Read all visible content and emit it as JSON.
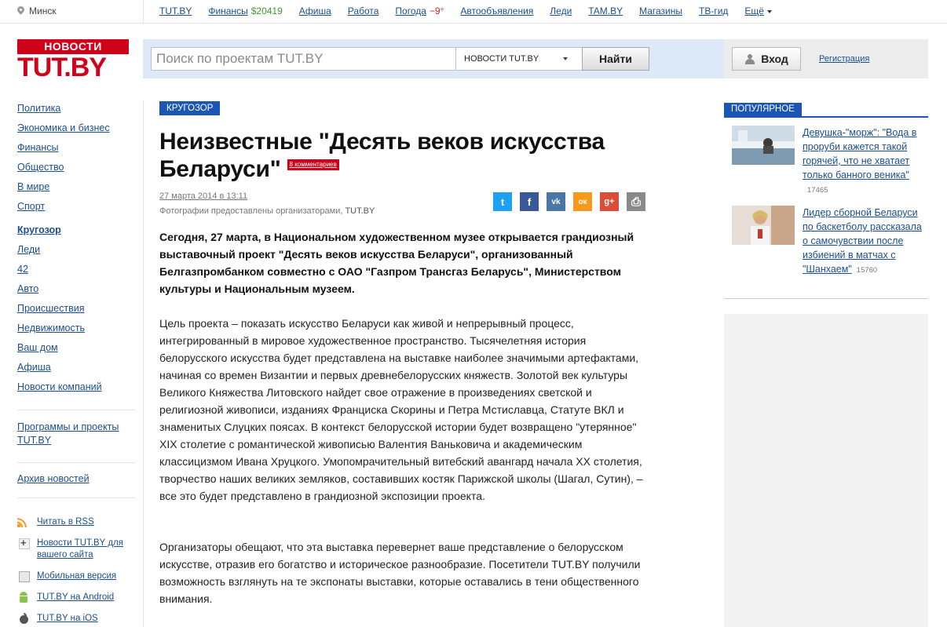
{
  "topbar": {
    "city": "Минск",
    "nav": [
      {
        "label": "TUT.BY"
      },
      {
        "label": "Финансы",
        "value": "$20419",
        "value_color": "#3a9b2a"
      },
      {
        "label": "Афиша"
      },
      {
        "label": "Работа"
      },
      {
        "label": "Погода",
        "value": "−9°",
        "value_color": "#c62828"
      },
      {
        "label": "Автообъявления"
      },
      {
        "label": "Леди"
      },
      {
        "label": "TAM.BY"
      },
      {
        "label": "Магазины"
      },
      {
        "label": "ТВ-гид"
      },
      {
        "label": "Ещё"
      }
    ]
  },
  "header": {
    "logo_top": "НОВОСТИ",
    "logo_main": "TUT.BY",
    "search_placeholder": "Поиск по проектам TUT.BY",
    "search_scope": "НОВОСТИ TUT.BY",
    "search_button": "Найти",
    "login_button": "Вход",
    "register_link": "Регистрация"
  },
  "sidebar": {
    "sections_group1": [
      "Политика",
      "Экономика и бизнес",
      "Финансы",
      "Общество",
      "В мире",
      "Спорт"
    ],
    "active": "Кругозор",
    "sections_group2": [
      "Леди",
      "42",
      "Авто",
      "Происшествия",
      "Недвижимость",
      "Ваш дом",
      "Афиша",
      "Новости компаний"
    ],
    "programs": "Программы и проекты TUT.BY",
    "archive": "Архив новостей",
    "services": [
      {
        "label": "Читать в RSS",
        "icon": "rss-icon"
      },
      {
        "label": "Новости TUT.BY для вашего сайта",
        "icon": "plus-icon"
      },
      {
        "label": "Мобильная версия",
        "icon": "mobile-icon"
      },
      {
        "label": "TUT.BY на Android",
        "icon": "android-icon"
      },
      {
        "label": "TUT.BY на iOS",
        "icon": "apple-icon"
      }
    ]
  },
  "article": {
    "rubric": "КРУГОЗОР",
    "title": "Неизвестные \"Десять веков искусства Беларуси\"",
    "comments": "8 комментариев",
    "date": "27 марта 2014 в 13:11",
    "photo_credit": "Фотографии предоставлены организаторами,",
    "photo_credit_source": "TUT.BY",
    "share": [
      {
        "icon": "twitter-icon",
        "glyph": "t",
        "color": "#1da1f2"
      },
      {
        "icon": "facebook-icon",
        "glyph": "f",
        "color": "#3b5998"
      },
      {
        "icon": "vkontakte-icon",
        "glyph": "vk",
        "color": "#4a76a8"
      },
      {
        "icon": "odnoklassniki-icon",
        "glyph": "ок",
        "color": "#f59a1c"
      },
      {
        "icon": "google-plus-icon",
        "glyph": "g+",
        "color": "#dd4b39"
      },
      {
        "icon": "print-icon",
        "glyph": "⎙",
        "color": "#8a8a8a"
      }
    ],
    "lead": "Сегодня, 27 марта, в Национальном художественном музее открывается грандиозный выставочный проект \"Десять веков искусства Беларуси\", организованный Белгазпромбанком совместно с ОАО \"Газпром Трансгаз Беларусь\", Министерством культуры и Национальным музеем.",
    "paragraphs": [
      "Цель проекта – показать искусство Беларуси как живой и непрерывный процесс, интегрированный в мировое художественное пространство. Тысячелетняя история белорусского искусства будет представлена на выставке наиболее значимыми артефактами, начиная со времен Византии и первых древнебелорусских княжеств. Золотой век культуры Великого Княжества Литовского найдет свое отражение в произведениях светской и религиозной живописи, изданиях Франциска Скорины и Петра Мстиславца, Статуте ВКЛ и знаменитых Слуцких поясах. В контекст белорусской истории будет возвращено \"утерянное\" XIX столетие с романтической живописью Валентия Ваньковича и академическим классицизмом Ивана Хруцкого. Умопомрачительный витебский авангард начала XX столетия, творчество наших великих земляков, составивших костяк Парижской школы (Шагал, Сутин), – все это будет представлено в грандиозной экспозиции проекта.",
      "Организаторы обещают, что эта выставка перевернет ваше представление о белорусском искусстве, отразив его богатство и историческое разнообразие. Посетители TUT.BY получили возможность взглянуть на те экспонаты выставки, которые оставались в тени общественного внимания."
    ]
  },
  "popular": {
    "tag": "ПОПУЛЯРНОЕ",
    "items": [
      {
        "title": "Девушка-\"морж\": \"Вода в проруби кажется такой горячей, что не хватает только банного веника\"",
        "views": "17465"
      },
      {
        "title": "Лидер сборной Беларуси по баскетболу рассказала о самочувствии после избиений в матчах с \"Шанхаем\"",
        "views": "15760"
      }
    ]
  }
}
